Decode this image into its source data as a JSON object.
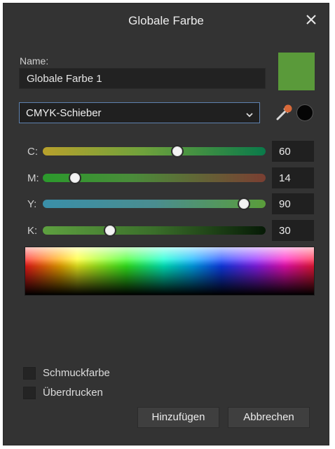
{
  "dialog": {
    "title": "Globale Farbe",
    "name_label": "Name:",
    "name_value": "Globale Farbe 1",
    "swatch_color": "#5a9a3a",
    "mode_selected": "CMYK-Schieber",
    "sliders": [
      {
        "label": "C:",
        "value": "60",
        "level": 0.6
      },
      {
        "label": "M:",
        "value": "14",
        "level": 0.14
      },
      {
        "label": "Y:",
        "value": "90",
        "level": 0.9
      },
      {
        "label": "K:",
        "value": "30",
        "level": 0.3
      }
    ],
    "checkboxes": [
      {
        "label": "Schmuckfarbe",
        "checked": false
      },
      {
        "label": "Überdrucken",
        "checked": false
      }
    ],
    "buttons": {
      "add": "Hinzufügen",
      "cancel": "Abbrechen"
    },
    "icons": [
      "close-icon",
      "chevron-down-icon",
      "eyedropper-icon"
    ]
  }
}
